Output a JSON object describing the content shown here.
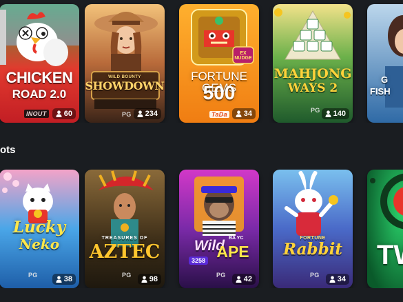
{
  "sections": [
    {
      "title": "",
      "cards": [
        {
          "name": "chicken-road",
          "title_line1": "CHICKEN",
          "title_line2": "ROAD 2.0",
          "provider": "INOUT",
          "players": "60"
        },
        {
          "name": "wild-bounty-showdown",
          "title_line1": "WILD BOUNTY",
          "title_line2": "SHOWDOWN",
          "provider": "PG",
          "players": "234"
        },
        {
          "name": "fortune-gems-500",
          "title_line1": "FORTUNE GEMS",
          "title_line2": "500",
          "badge": "EX NUDGE",
          "provider": "TaDa",
          "players": "34"
        },
        {
          "name": "mahjong-ways-2",
          "title_line1": "MAHJONG",
          "title_line2": "WAYS 2",
          "provider": "PG",
          "players": "140"
        },
        {
          "name": "gates-fish",
          "title_line1": "G",
          "title_line2": "FISH",
          "provider": "",
          "players": ""
        }
      ]
    },
    {
      "title": "ots",
      "cards": [
        {
          "name": "lucky-neko",
          "title_line1": "Lucky",
          "title_line2": "Neko",
          "provider": "PG",
          "players": "38"
        },
        {
          "name": "treasures-of-aztec",
          "title_line1": "TREASURES OF",
          "title_line2": "AZTEC",
          "provider": "PG",
          "players": "98"
        },
        {
          "name": "wild-ape",
          "title_line1": "Wild",
          "title_line2": "APE",
          "tag": "3258",
          "badge": "BA YC",
          "provider": "PG",
          "players": "42"
        },
        {
          "name": "fortune-rabbit",
          "title_line1": "FORTUNE",
          "title_line2": "Rabbit",
          "provider": "PG",
          "players": "34"
        },
        {
          "name": "twist",
          "title_line1": "TW",
          "title_line2": "",
          "provider": "",
          "players": ""
        }
      ]
    }
  ],
  "colors": {
    "background": "#1a1d21",
    "chicken": "#d9252b",
    "showdown": "#6b3a22",
    "fortune_gems": "#f18a1a",
    "mahjong": "#2c7a3c",
    "gates_fish": "#3a6ea8",
    "lucky_neko": "#2a8ad8",
    "aztec": "#5b4a2a",
    "wild_ape": "#b52bbd",
    "rabbit": "#d23a6b",
    "twist": "#1a9a4a"
  }
}
